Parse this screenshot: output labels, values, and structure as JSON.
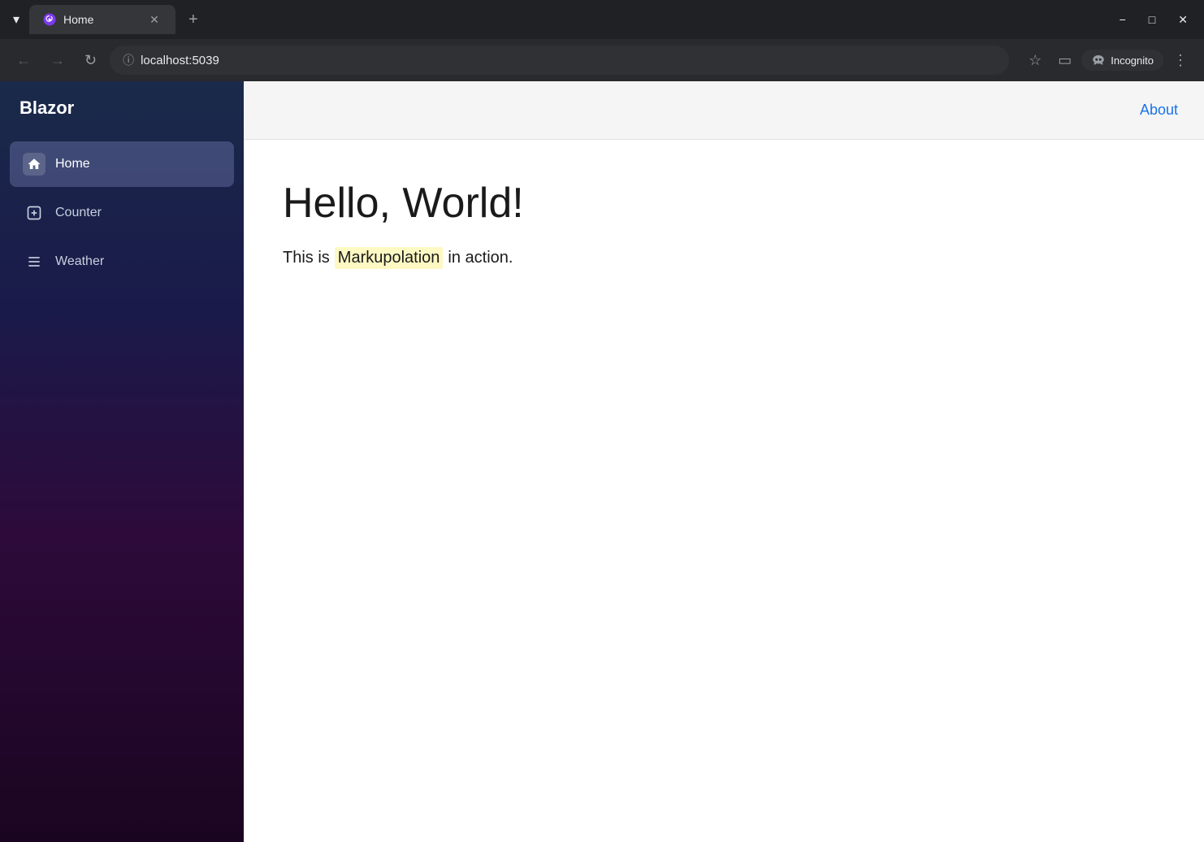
{
  "browser": {
    "tab_title": "Home",
    "url_display": "localhost:5039",
    "url_host_highlight": "localhost",
    "url_port": ":5039",
    "incognito_label": "Incognito",
    "new_tab_icon": "+",
    "back_icon": "←",
    "forward_icon": "→",
    "reload_icon": "↻",
    "minimize_icon": "−",
    "maximize_icon": "□",
    "close_icon": "✕"
  },
  "sidebar": {
    "brand": "Blazor",
    "nav_items": [
      {
        "id": "home",
        "label": "Home",
        "icon": "🏠",
        "active": true
      },
      {
        "id": "counter",
        "label": "Counter",
        "icon": "+",
        "active": false
      },
      {
        "id": "weather",
        "label": "Weather",
        "icon": "≡",
        "active": false
      }
    ]
  },
  "topbar": {
    "about_label": "About"
  },
  "page": {
    "title": "Hello, World!",
    "subtitle_prefix": "This is ",
    "subtitle_highlight": "Markupolation",
    "subtitle_suffix": " in action."
  }
}
